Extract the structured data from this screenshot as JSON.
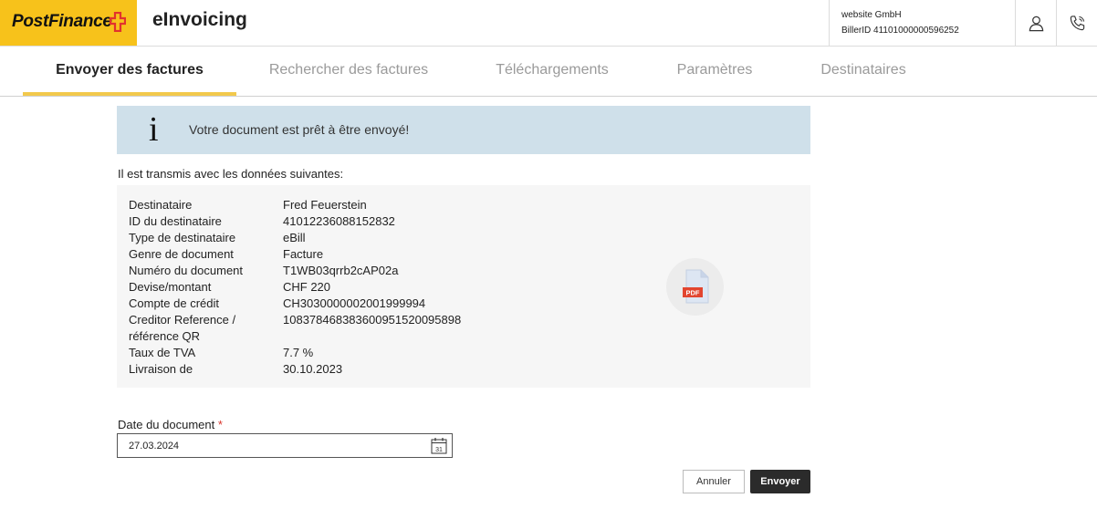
{
  "header": {
    "logo_text": "PostFinance",
    "app_title": "eInvoicing",
    "company": "website GmbH",
    "biller_id": "BillerID 41101000000596252",
    "icons": [
      "user-icon",
      "phone-icon"
    ],
    "brand_color": "#f7c21b",
    "logo_cross_color": "#e2322d"
  },
  "nav": {
    "tabs": [
      {
        "label": "Envoyer des factures",
        "active": true
      },
      {
        "label": "Rechercher des factures",
        "active": false
      },
      {
        "label": "Téléchargements",
        "active": false
      },
      {
        "label": "Paramètres",
        "active": false
      },
      {
        "label": "Destinataires",
        "active": false
      }
    ],
    "active_color": "#f2c94c"
  },
  "info": {
    "icon": "info-icon",
    "message": "Votre document est prêt à être envoyé!",
    "background": "#cfe0ea"
  },
  "intro": "Il est transmis avec les données suivantes:",
  "details": {
    "rows": [
      {
        "label": "Destinataire",
        "value": "Fred Feuerstein"
      },
      {
        "label": "ID du destinataire",
        "value": "41012236088152832"
      },
      {
        "label": "Type de destinataire",
        "value": "eBill"
      },
      {
        "label": "Genre de document",
        "value": "Facture"
      },
      {
        "label": "Numéro du document",
        "value": "T1WB03qrrb2cAP02a"
      },
      {
        "label": "Devise/montant",
        "value": "CHF 220"
      },
      {
        "label": "Compte de crédit",
        "value": "CH3030000002001999994"
      },
      {
        "label": "Creditor Reference /",
        "value": "108378468383600951520095898"
      },
      {
        "label": "référence QR",
        "value": ""
      },
      {
        "label": "Taux de TVA",
        "value": "7.7 %"
      },
      {
        "label": "Livraison de",
        "value": "30.10.2023"
      }
    ],
    "pdf_badge": "PDF",
    "pdf_color": "#e2452f"
  },
  "date_field": {
    "label": "Date du document",
    "required_mark": "*",
    "value": "27.03.2024",
    "calendar_day": "31"
  },
  "actions": {
    "cancel_label": "Annuler",
    "send_label": "Envoyer"
  }
}
